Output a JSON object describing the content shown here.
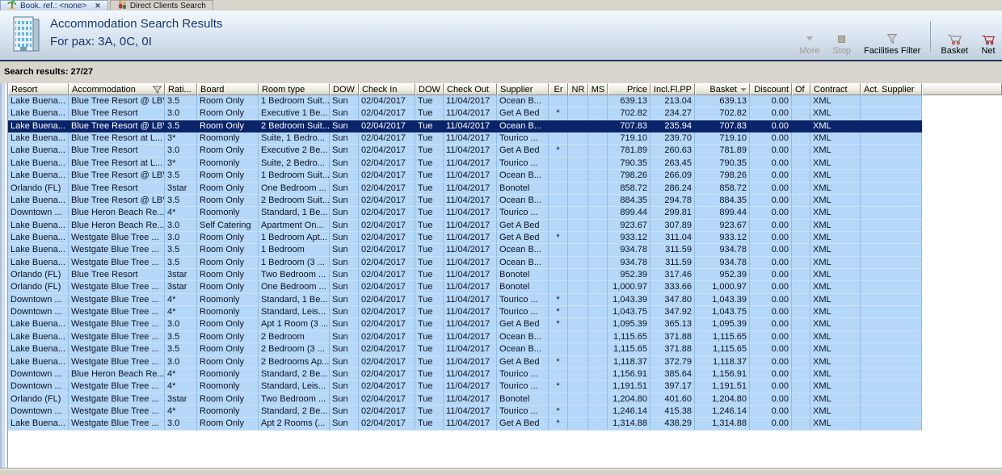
{
  "tabs": [
    {
      "label": "Book. ref.: <none>",
      "icon": "palm-tree",
      "active": true,
      "closable": true
    },
    {
      "label": "Direct Clients Search",
      "icon": "clients",
      "active": false
    }
  ],
  "header": {
    "title": "Accommodation Search Results",
    "subtitle": "For pax: 3A, 0C, 0I"
  },
  "toolbar": {
    "more": "More",
    "stop": "Stop",
    "facilities_filter": "Facilities Filter",
    "basket": "Basket",
    "net": "Net"
  },
  "results_label": "Search results: 27/27",
  "colors": {
    "selection": "#0a246a",
    "row_background": "#b5d7f8",
    "title_navy": "#17366f"
  },
  "table": {
    "selected_row_index": 2,
    "columns": [
      {
        "label": "Resort"
      },
      {
        "label": "Accommodation",
        "icon": "filter"
      },
      {
        "label": "Rati..."
      },
      {
        "label": "Board"
      },
      {
        "label": "Room type"
      },
      {
        "label": "DOW"
      },
      {
        "label": "Check In"
      },
      {
        "label": "DOW"
      },
      {
        "label": "Check Out"
      },
      {
        "label": "Supplier"
      },
      {
        "label": "Er"
      },
      {
        "label": "NR"
      },
      {
        "label": "MS"
      },
      {
        "label": "Price"
      },
      {
        "label": "Incl.Fl.PP"
      },
      {
        "label": "Basket",
        "icon": "sort-down"
      },
      {
        "label": "Discount"
      },
      {
        "label": "Of"
      },
      {
        "label": "Contract"
      },
      {
        "label": "Act. Supplier"
      }
    ],
    "rows": [
      [
        "Lake Buena...",
        "Blue Tree Resort @ LBV",
        "3.5",
        "Room Only",
        "1 Bedroom Suit...",
        "Sun",
        "02/04/2017",
        "Tue",
        "11/04/2017",
        "Ocean B...",
        "",
        "",
        "",
        "639.13",
        "213.04",
        "639.13",
        "0.00",
        "",
        "XML",
        ""
      ],
      [
        "Lake Buena...",
        "Blue Tree Resort",
        "3.0",
        "Room Only",
        "Executive 1 Be...",
        "Sun",
        "02/04/2017",
        "Tue",
        "11/04/2017",
        "Get A Bed",
        "*",
        "",
        "",
        "702.82",
        "234.27",
        "702.82",
        "0.00",
        "",
        "XML",
        ""
      ],
      [
        "Lake Buena...",
        "Blue Tree Resort @ LBV",
        "3.5",
        "Room Only",
        "2 Bedroom Suit...",
        "Sun",
        "02/04/2017",
        "Tue",
        "11/04/2017",
        "Ocean B...",
        "",
        "",
        "",
        "707.83",
        "235.94",
        "707.83",
        "0.00",
        "",
        "XML",
        ""
      ],
      [
        "Lake Buena...",
        "Blue Tree Resort at L...",
        "3*",
        "Roomonly",
        "Suite, 1 Bedro...",
        "Sun",
        "02/04/2017",
        "Tue",
        "11/04/2017",
        "Tourico ...",
        "",
        "",
        "",
        "719.10",
        "239.70",
        "719.10",
        "0.00",
        "",
        "XML",
        ""
      ],
      [
        "Lake Buena...",
        "Blue Tree Resort",
        "3.0",
        "Room Only",
        "Executive 2 Be...",
        "Sun",
        "02/04/2017",
        "Tue",
        "11/04/2017",
        "Get A Bed",
        "*",
        "",
        "",
        "781.89",
        "260.63",
        "781.89",
        "0.00",
        "",
        "XML",
        ""
      ],
      [
        "Lake Buena...",
        "Blue Tree Resort at L...",
        "3*",
        "Roomonly",
        "Suite, 2 Bedro...",
        "Sun",
        "02/04/2017",
        "Tue",
        "11/04/2017",
        "Tourico ...",
        "",
        "",
        "",
        "790.35",
        "263.45",
        "790.35",
        "0.00",
        "",
        "XML",
        ""
      ],
      [
        "Lake Buena...",
        "Blue Tree Resort @ LBV",
        "3.5",
        "Room Only",
        "1 Bedroom Suit...",
        "Sun",
        "02/04/2017",
        "Tue",
        "11/04/2017",
        "Ocean B...",
        "",
        "",
        "",
        "798.26",
        "266.09",
        "798.26",
        "0.00",
        "",
        "XML",
        ""
      ],
      [
        "Orlando (FL)",
        "Blue Tree Resort",
        "3star",
        "Room Only",
        "One Bedroom ...",
        "Sun",
        "02/04/2017",
        "Tue",
        "11/04/2017",
        "Bonotel",
        "",
        "",
        "",
        "858.72",
        "286.24",
        "858.72",
        "0.00",
        "",
        "XML",
        ""
      ],
      [
        "Lake Buena...",
        "Blue Tree Resort @ LBV",
        "3.5",
        "Room Only",
        "2 Bedroom Suit...",
        "Sun",
        "02/04/2017",
        "Tue",
        "11/04/2017",
        "Ocean B...",
        "",
        "",
        "",
        "884.35",
        "294.78",
        "884.35",
        "0.00",
        "",
        "XML",
        ""
      ],
      [
        "Downtown ...",
        "Blue Heron Beach Re...",
        "4*",
        "Roomonly",
        "Standard, 1 Be...",
        "Sun",
        "02/04/2017",
        "Tue",
        "11/04/2017",
        "Tourico ...",
        "",
        "",
        "",
        "899.44",
        "299.81",
        "899.44",
        "0.00",
        "",
        "XML",
        ""
      ],
      [
        "Lake Buena...",
        "Blue Heron Beach Re...",
        "3.0",
        "Self Catering",
        "Apartment On...",
        "Sun",
        "02/04/2017",
        "Tue",
        "11/04/2017",
        "Get A Bed",
        "",
        "",
        "",
        "923.67",
        "307.89",
        "923.67",
        "0.00",
        "",
        "XML",
        ""
      ],
      [
        "Lake Buena...",
        "Westgate Blue Tree ...",
        "3.0",
        "Room Only",
        "1 Bedroom Apt...",
        "Sun",
        "02/04/2017",
        "Tue",
        "11/04/2017",
        "Get A Bed",
        "*",
        "",
        "",
        "933.12",
        "311.04",
        "933.12",
        "0.00",
        "",
        "XML",
        ""
      ],
      [
        "Lake Buena...",
        "Westgate Blue Tree ...",
        "3.5",
        "Room Only",
        "1 Bedroom",
        "Sun",
        "02/04/2017",
        "Tue",
        "11/04/2017",
        "Ocean B...",
        "",
        "",
        "",
        "934.78",
        "311.59",
        "934.78",
        "0.00",
        "",
        "XML",
        ""
      ],
      [
        "Lake Buena...",
        "Westgate Blue Tree ...",
        "3.5",
        "Room Only",
        "1 Bedroom (3 ...",
        "Sun",
        "02/04/2017",
        "Tue",
        "11/04/2017",
        "Ocean B...",
        "",
        "",
        "",
        "934.78",
        "311.59",
        "934.78",
        "0.00",
        "",
        "XML",
        ""
      ],
      [
        "Orlando (FL)",
        "Blue Tree Resort",
        "3star",
        "Room Only",
        "Two Bedroom ...",
        "Sun",
        "02/04/2017",
        "Tue",
        "11/04/2017",
        "Bonotel",
        "",
        "",
        "",
        "952.39",
        "317.46",
        "952.39",
        "0.00",
        "",
        "XML",
        ""
      ],
      [
        "Orlando (FL)",
        "Westgate Blue Tree ...",
        "3star",
        "Room Only",
        "One Bedroom ...",
        "Sun",
        "02/04/2017",
        "Tue",
        "11/04/2017",
        "Bonotel",
        "",
        "",
        "",
        "1,000.97",
        "333.66",
        "1,000.97",
        "0.00",
        "",
        "XML",
        ""
      ],
      [
        "Downtown ...",
        "Westgate Blue Tree ...",
        "4*",
        "Roomonly",
        "Standard, 1 Be...",
        "Sun",
        "02/04/2017",
        "Tue",
        "11/04/2017",
        "Tourico ...",
        "*",
        "",
        "",
        "1,043.39",
        "347.80",
        "1,043.39",
        "0.00",
        "",
        "XML",
        ""
      ],
      [
        "Downtown ...",
        "Westgate Blue Tree ...",
        "4*",
        "Roomonly",
        "Standard, Leis...",
        "Sun",
        "02/04/2017",
        "Tue",
        "11/04/2017",
        "Tourico ...",
        "*",
        "",
        "",
        "1,043.75",
        "347.92",
        "1,043.75",
        "0.00",
        "",
        "XML",
        ""
      ],
      [
        "Lake Buena...",
        "Westgate Blue Tree ...",
        "3.0",
        "Room Only",
        "Apt 1 Room (3 ...",
        "Sun",
        "02/04/2017",
        "Tue",
        "11/04/2017",
        "Get A Bed",
        "*",
        "",
        "",
        "1,095.39",
        "365.13",
        "1,095.39",
        "0.00",
        "",
        "XML",
        ""
      ],
      [
        "Lake Buena...",
        "Westgate Blue Tree ...",
        "3.5",
        "Room Only",
        "2 Bedroom",
        "Sun",
        "02/04/2017",
        "Tue",
        "11/04/2017",
        "Ocean B...",
        "",
        "",
        "",
        "1,115.65",
        "371.88",
        "1,115.65",
        "0.00",
        "",
        "XML",
        ""
      ],
      [
        "Lake Buena...",
        "Westgate Blue Tree ...",
        "3.5",
        "Room Only",
        "2 Bedroom (3 ...",
        "Sun",
        "02/04/2017",
        "Tue",
        "11/04/2017",
        "Ocean B...",
        "",
        "",
        "",
        "1,115.65",
        "371.88",
        "1,115.65",
        "0.00",
        "",
        "XML",
        ""
      ],
      [
        "Lake Buena...",
        "Westgate Blue Tree ...",
        "3.0",
        "Room Only",
        "2 Bedrooms Ap...",
        "Sun",
        "02/04/2017",
        "Tue",
        "11/04/2017",
        "Get A Bed",
        "*",
        "",
        "",
        "1,118.37",
        "372.79",
        "1,118.37",
        "0.00",
        "",
        "XML",
        ""
      ],
      [
        "Downtown ...",
        "Blue Heron Beach Re...",
        "4*",
        "Roomonly",
        "Standard, 2 Be...",
        "Sun",
        "02/04/2017",
        "Tue",
        "11/04/2017",
        "Tourico ...",
        "",
        "",
        "",
        "1,156.91",
        "385.64",
        "1,156.91",
        "0.00",
        "",
        "XML",
        ""
      ],
      [
        "Downtown ...",
        "Westgate Blue Tree ...",
        "4*",
        "Roomonly",
        "Standard, Leis...",
        "Sun",
        "02/04/2017",
        "Tue",
        "11/04/2017",
        "Tourico ...",
        "*",
        "",
        "",
        "1,191.51",
        "397.17",
        "1,191.51",
        "0.00",
        "",
        "XML",
        ""
      ],
      [
        "Orlando (FL)",
        "Westgate Blue Tree ...",
        "3star",
        "Room Only",
        "Two Bedroom ...",
        "Sun",
        "02/04/2017",
        "Tue",
        "11/04/2017",
        "Bonotel",
        "",
        "",
        "",
        "1,204.80",
        "401.60",
        "1,204.80",
        "0.00",
        "",
        "XML",
        ""
      ],
      [
        "Downtown ...",
        "Westgate Blue Tree ...",
        "4*",
        "Roomonly",
        "Standard, 2 Be...",
        "Sun",
        "02/04/2017",
        "Tue",
        "11/04/2017",
        "Tourico ...",
        "*",
        "",
        "",
        "1,246.14",
        "415.38",
        "1,246.14",
        "0.00",
        "",
        "XML",
        ""
      ],
      [
        "Lake Buena...",
        "Westgate Blue Tree ...",
        "3.0",
        "Room Only",
        "Apt 2 Rooms (...",
        "Sun",
        "02/04/2017",
        "Tue",
        "11/04/2017",
        "Get A Bed",
        "*",
        "",
        "",
        "1,314.88",
        "438.29",
        "1,314.88",
        "0.00",
        "",
        "XML",
        ""
      ]
    ]
  }
}
